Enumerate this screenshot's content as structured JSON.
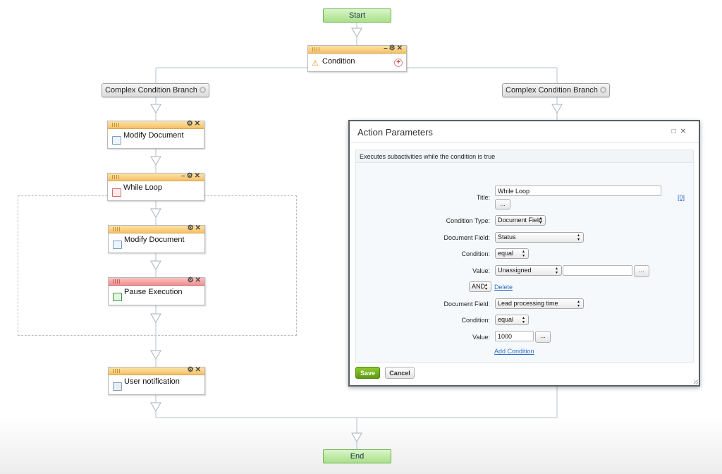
{
  "workflow": {
    "start_label": "Start",
    "end_label": "End",
    "condition_label": "Condition",
    "branch_left_label": "Complex Condition Branch",
    "branch_right_label": "Complex Condition Branch",
    "activities": {
      "modify_document_1": "Modify Document",
      "while_loop": "While Loop",
      "modify_document_2": "Modify Document",
      "pause_execution": "Pause Execution",
      "user_notification": "User notification"
    }
  },
  "dialog": {
    "title": "Action Parameters",
    "description": "Executes subactivities while the condition is true",
    "fields": {
      "title_label": "Title:",
      "title_value": "While Loop",
      "title_extra": "[0]",
      "ellipsis": "...",
      "condition_type_label": "Condition Type:",
      "condition_type_value": "Document Field",
      "document_field_label": "Document Field:",
      "document_field_value": "Status",
      "condition_label": "Condition:",
      "condition_value": "equal",
      "value_label": "Value:",
      "value_value": "Unassigned",
      "operator_value": "AND",
      "delete_link": "Delete",
      "document_field_2_label": "Document Field:",
      "document_field_2_value": "Lead processing time",
      "condition_2_label": "Condition:",
      "condition_2_value": "equal",
      "value_2_label": "Value:",
      "value_2_value": "1000",
      "add_condition_link": "Add Condition"
    },
    "save_label": "Save",
    "cancel_label": "Cancel"
  },
  "icons": {
    "minimize": "minimize-icon",
    "settings": "gear-icon",
    "close": "close-icon",
    "add": "plus-icon"
  },
  "colors": {
    "activity_header": "#f5c065",
    "pause_header": "#f08f8f",
    "terminal": "#a9e08a",
    "save_button": "#5c9a12",
    "link": "#2b6fc9"
  }
}
